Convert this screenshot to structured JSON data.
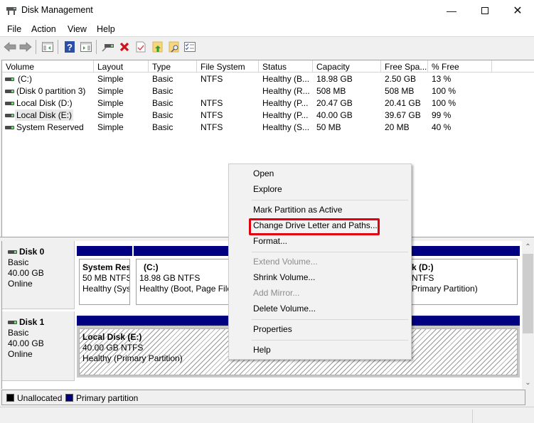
{
  "window": {
    "title": "Disk Management",
    "app_icon": "disk-management-icon",
    "controls": [
      "minimize",
      "maximize",
      "close"
    ]
  },
  "menubar": {
    "items": [
      {
        "label": "File"
      },
      {
        "label": "Action"
      },
      {
        "label": "View"
      },
      {
        "label": "Help"
      }
    ]
  },
  "toolbar": {
    "buttons": [
      {
        "icon": "back-arrow-icon"
      },
      {
        "icon": "forward-arrow-icon"
      },
      {
        "icon": "show-hide-console-tree-icon"
      },
      {
        "icon": "help-icon"
      },
      {
        "icon": "show-hide-action-pane-icon"
      },
      {
        "icon": "connect-disk-icon"
      },
      {
        "icon": "delete-icon"
      },
      {
        "icon": "properties-check-icon"
      },
      {
        "icon": "folder-up-icon"
      },
      {
        "icon": "folder-search-icon"
      },
      {
        "icon": "checklist-icon"
      }
    ]
  },
  "volume_list": {
    "columns": [
      "Volume",
      "Layout",
      "Type",
      "File System",
      "Status",
      "Capacity",
      "Free Spa...",
      "% Free"
    ],
    "rows": [
      {
        "volume": "(C:)",
        "layout": "Simple",
        "type": "Basic",
        "fs": "NTFS",
        "status": "Healthy (B...",
        "capacity": "18.98 GB",
        "free": "2.50 GB",
        "pct": "13 %"
      },
      {
        "volume": "(Disk 0 partition 3)",
        "layout": "Simple",
        "type": "Basic",
        "fs": "",
        "status": "Healthy (R...",
        "capacity": "508 MB",
        "free": "508 MB",
        "pct": "100 %"
      },
      {
        "volume": "Local Disk (D:)",
        "layout": "Simple",
        "type": "Basic",
        "fs": "NTFS",
        "status": "Healthy (P...",
        "capacity": "20.47 GB",
        "free": "20.41 GB",
        "pct": "100 %"
      },
      {
        "volume": "Local Disk (E:)",
        "layout": "Simple",
        "type": "Basic",
        "fs": "NTFS",
        "status": "Healthy (P...",
        "capacity": "40.00 GB",
        "free": "39.67 GB",
        "pct": "99 %"
      },
      {
        "volume": "System Reserved",
        "layout": "Simple",
        "type": "Basic",
        "fs": "NTFS",
        "status": "Healthy (S...",
        "capacity": "50 MB",
        "free": "20 MB",
        "pct": "40 %"
      }
    ]
  },
  "disks": [
    {
      "name": "Disk 0",
      "type": "Basic",
      "size": "40.00 GB",
      "state": "Online",
      "partitions": [
        {
          "name": "System Res",
          "size": "50 MB NTFS",
          "status": "Healthy (Sys"
        },
        {
          "name": "(C:)",
          "size": "18.98 GB NTFS",
          "status": "Healthy (Boot, Page File"
        },
        {
          "name": "k  (D:)",
          "size": "NTFS",
          "status": "Primary Partition)"
        }
      ]
    },
    {
      "name": "Disk 1",
      "type": "Basic",
      "size": "40.00 GB",
      "state": "Online",
      "partitions": [
        {
          "name": "Local Disk  (E:)",
          "size": "40.00 GB NTFS",
          "status": "Healthy (Primary Partition)"
        }
      ]
    }
  ],
  "legend": {
    "items": [
      {
        "label": "Unallocated",
        "color": "#000000"
      },
      {
        "label": "Primary partition",
        "color": "#000080"
      }
    ]
  },
  "context_menu": {
    "items": [
      {
        "label": "Open",
        "enabled": true
      },
      {
        "label": "Explore",
        "enabled": true
      },
      {
        "label": "Mark Partition as Active",
        "enabled": true
      },
      {
        "label": "Change Drive Letter and Paths...",
        "enabled": true,
        "highlighted": true
      },
      {
        "label": "Format...",
        "enabled": true
      },
      {
        "label": "Extend Volume...",
        "enabled": false
      },
      {
        "label": "Shrink Volume...",
        "enabled": true
      },
      {
        "label": "Add Mirror...",
        "enabled": false
      },
      {
        "label": "Delete Volume...",
        "enabled": true
      },
      {
        "label": "Properties",
        "enabled": true
      },
      {
        "label": "Help",
        "enabled": true
      }
    ]
  },
  "colors": {
    "primary_partition": "#000080",
    "highlight_box": "#e0000e"
  }
}
